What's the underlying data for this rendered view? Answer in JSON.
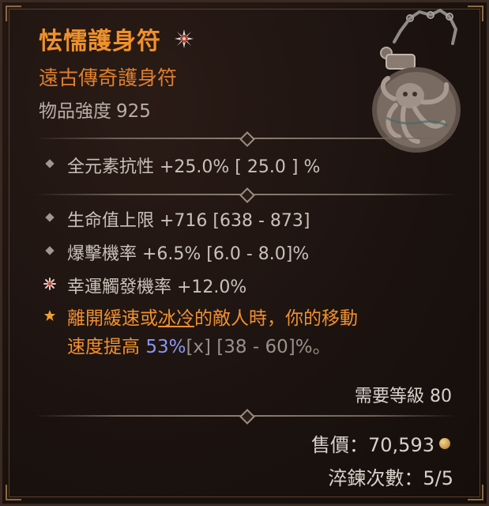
{
  "item": {
    "name": "怯懦護身符",
    "rarity_line": "遠古傳奇護身符",
    "power_label": "物品強度",
    "power_value": "925",
    "rarity_icon": "star-flower-icon",
    "image_icon": "octopus-amulet-icon"
  },
  "implicit_affixes": [
    {
      "text": "全元素抗性 +25.0%  [ 25.0 ] %"
    }
  ],
  "affixes": [
    {
      "text": "生命值上限 +716 [638 - 873]"
    },
    {
      "text": "爆擊機率 +6.5% [6.0 - 8.0]%"
    },
    {
      "text": "幸運觸發機率 +12.0%"
    }
  ],
  "legendary": {
    "before_kw": "離開緩速或",
    "keyword": "冰冷",
    "after_kw": "的敵人時，你的移動",
    "line2_prefix": "速度提高 ",
    "value": "53%",
    "marker": "[x]",
    "range": " [38 - 60]%。"
  },
  "requirement": "需要等級 80",
  "sell_label": "售價：70,593",
  "temper_label": "淬鍊次數：5/5",
  "colors": {
    "title": "#f0912a",
    "legendary": "#f09030",
    "value_highlight": "#8a96f0"
  }
}
